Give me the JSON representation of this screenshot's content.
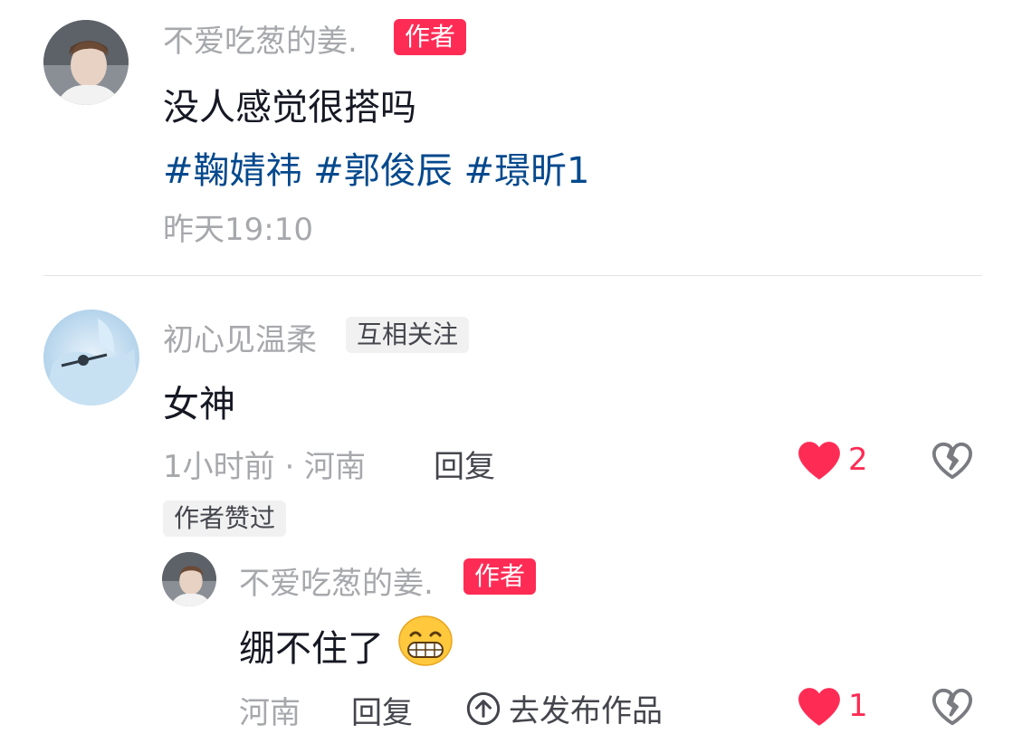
{
  "colors": {
    "accent": "#fe2c55",
    "hashtag": "#04498d",
    "meta": "#a7a8ac"
  },
  "comments": [
    {
      "username": "不爱吃葱的姜.",
      "badge": "作者",
      "text": "没人感觉很搭吗",
      "tags": "#鞠婧祎 #郭俊辰 #璟昕1",
      "time": "昨天19:10"
    },
    {
      "username": "初心见温柔",
      "badge": "互相关注",
      "text": "女神",
      "meta": "1小时前 · 河南",
      "reply_label": "回复",
      "like_count": "2",
      "author_liked": "作者赞过",
      "replies": [
        {
          "username": "不爱吃葱的姜.",
          "badge": "作者",
          "text": "绷不住了",
          "emoji": "grinning-face",
          "location": "河南",
          "reply_label": "回复",
          "publish_label": "去发布作品",
          "like_count": "1"
        }
      ]
    }
  ]
}
